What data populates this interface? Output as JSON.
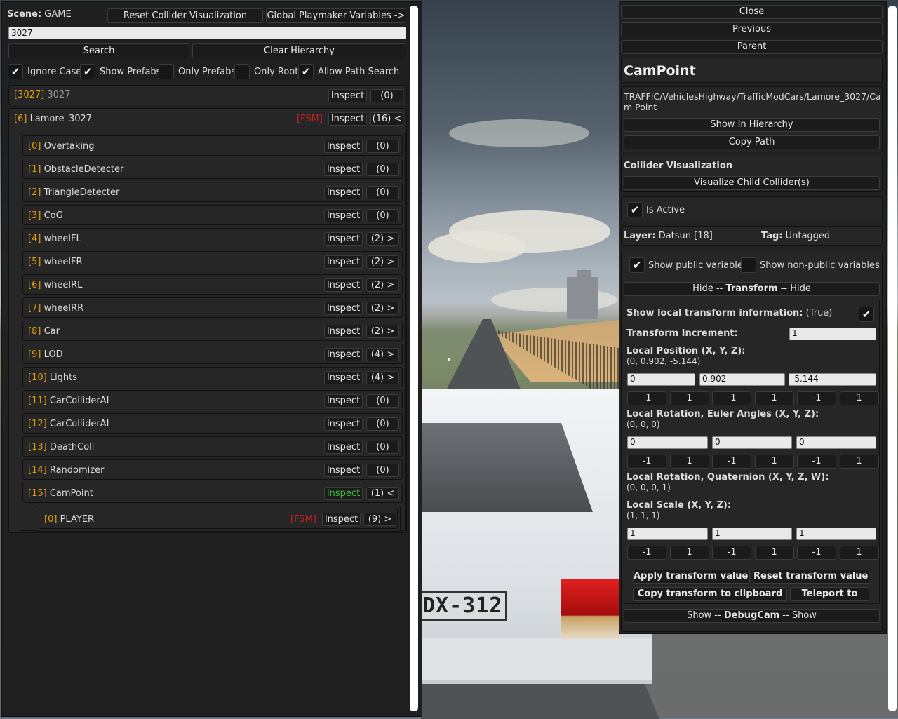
{
  "left": {
    "scene_label": "Scene:",
    "scene_name": "GAME",
    "reset_collider": "Reset Collider Visualization",
    "global_vars": "Global Playmaker Variables ->",
    "search_value": "3027",
    "search_btn": "Search",
    "clear_btn": "Clear Hierarchy",
    "options": {
      "ignore_case": "Ignore Case",
      "show_prefabs": "Show Prefabs",
      "only_prefabs": "Only Prefabs",
      "only_root": "Only Root",
      "allow_path": "Allow Path Search"
    },
    "check_mark": "✔",
    "inspect": "Inspect",
    "fsm": "[FSM]",
    "root_item": {
      "index": "[3027]",
      "name": "3027",
      "count": "(0)"
    },
    "parent_item": {
      "index": "[6]",
      "name": "Lamore_3027",
      "count": "(16) <"
    },
    "children": [
      {
        "index": "[0]",
        "name": "Overtaking",
        "count": "(0)"
      },
      {
        "index": "[1]",
        "name": "ObstacleDetecter",
        "count": "(0)"
      },
      {
        "index": "[2]",
        "name": "TriangleDetecter",
        "count": "(0)"
      },
      {
        "index": "[3]",
        "name": "CoG",
        "count": "(0)"
      },
      {
        "index": "[4]",
        "name": "wheelFL",
        "count": "(2) >"
      },
      {
        "index": "[5]",
        "name": "wheelFR",
        "count": "(2) >"
      },
      {
        "index": "[6]",
        "name": "wheelRL",
        "count": "(2) >"
      },
      {
        "index": "[7]",
        "name": "wheelRR",
        "count": "(2) >"
      },
      {
        "index": "[8]",
        "name": "Car",
        "count": "(2) >"
      },
      {
        "index": "[9]",
        "name": "LOD",
        "count": "(4) >"
      },
      {
        "index": "[10]",
        "name": "Lights",
        "count": "(4) >"
      },
      {
        "index": "[11]",
        "name": "CarColliderAI",
        "count": "(0)"
      },
      {
        "index": "[12]",
        "name": "CarColliderAI",
        "count": "(0)"
      },
      {
        "index": "[13]",
        "name": "DeathColl",
        "count": "(0)"
      },
      {
        "index": "[14]",
        "name": "Randomizer",
        "count": "(0)"
      },
      {
        "index": "[15]",
        "name": "CamPoint",
        "count": "(1) <"
      }
    ],
    "grandchild": {
      "index": "[0]",
      "name": "PLAYER",
      "count": "(9) >"
    }
  },
  "right": {
    "close": "Close",
    "previous": "Previous",
    "parent": "Parent",
    "title": "CamPoint",
    "path": "TRAFFIC/VehiclesHighway/TrafficModCars/Lamore_3027/Cam Point",
    "show_in_hierarchy": "Show In Hierarchy",
    "copy_path": "Copy Path",
    "collider_title": "Collider Visualization",
    "visualize": "Visualize Child Collider(s)",
    "is_active": "Is Active",
    "layer_label": "Layer:",
    "layer_value": "Datsun [18]",
    "tag_label": "Tag:",
    "tag_value": "Untagged",
    "show_public": "Show public variables",
    "show_nonpublic": "Show non-public variables",
    "transform_pre": "Hide -- ",
    "transform_title": "Transform",
    "transform_post": " -- Hide",
    "local_info_label": "Show local transform information:",
    "local_info_value": "(True)",
    "increment_label": "Transform Increment:",
    "increment_value": "1",
    "pos_label": "Local Position (X, Y, Z):",
    "pos_value": "(0, 0.902, -5.144)",
    "pos": [
      "0",
      "0.902",
      "-5.144"
    ],
    "rot_label": "Local Rotation, Euler Angles (X, Y, Z):",
    "rot_value": "(0, 0, 0)",
    "rot": [
      "0",
      "0",
      "0"
    ],
    "quat_label": "Local Rotation, Quaternion (X, Y, Z, W):",
    "quat_value": "(0, 0, 0, 1)",
    "scale_label": "Local Scale (X, Y, Z):",
    "scale_value": "(1, 1, 1)",
    "scale": [
      "1",
      "1",
      "1"
    ],
    "steps": [
      "-1",
      "1",
      "-1",
      "1",
      "-1",
      "1"
    ],
    "apply": "Apply transform values",
    "reset": "Reset transform values",
    "copy_clipboard": "Copy transform to clipboard",
    "teleport": "Teleport to",
    "debug_pre": "Show -- ",
    "debug_title": "DebugCam",
    "debug_post": " -- Show"
  },
  "scene": {
    "plate": "DX-312"
  },
  "colors": {
    "index": "#e0a012",
    "fsm": "#c82020",
    "active_inspect": "#3dbd3d"
  }
}
